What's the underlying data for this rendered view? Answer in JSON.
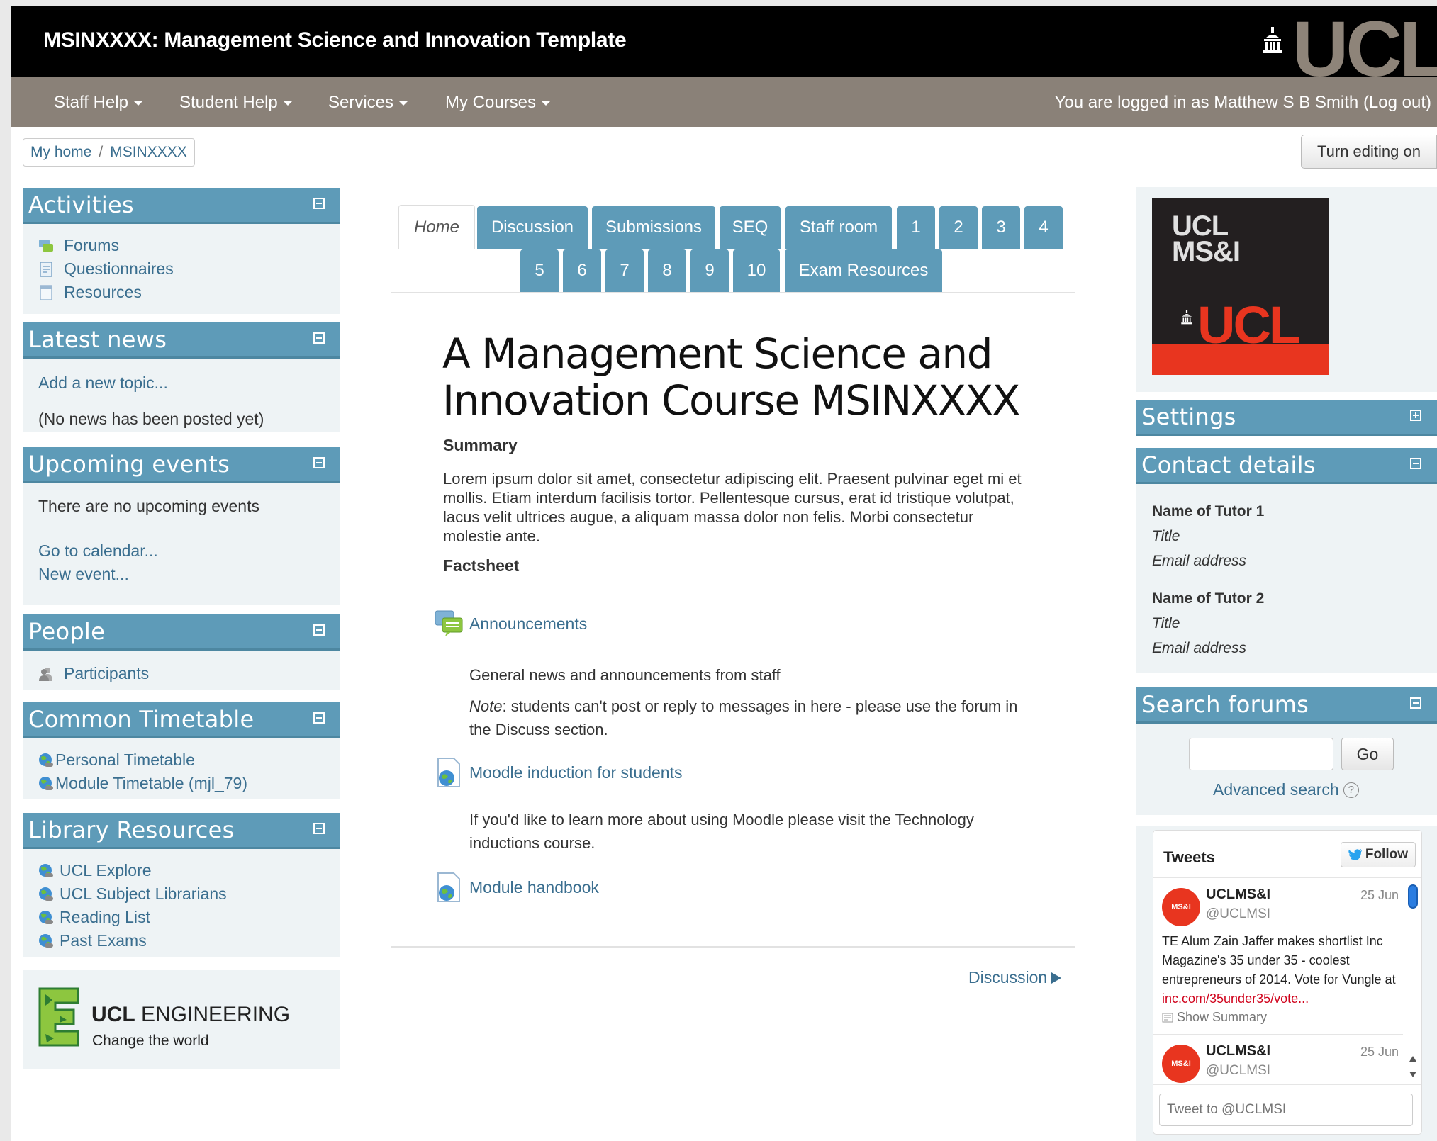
{
  "header": {
    "site_title": "MSINXXXX: Management Science and Innovation Template",
    "logo_text": "UCL"
  },
  "nav": {
    "items": [
      "Staff Help",
      "Student Help",
      "Services",
      "My Courses"
    ],
    "login_prefix": "You are logged in as Matthew S B Smith",
    "logout": "(Log out)"
  },
  "breadcrumb": {
    "home": "My home",
    "sep": "/",
    "course": "MSINXXXX"
  },
  "edit_button": "Turn editing on",
  "blocks": {
    "activities": {
      "title": "Activities",
      "items": [
        "Forums",
        "Questionnaires",
        "Resources"
      ]
    },
    "latest_news": {
      "title": "Latest news",
      "add": "Add a new topic...",
      "empty": "(No news has been posted yet)"
    },
    "upcoming": {
      "title": "Upcoming events",
      "empty": "There are no upcoming events",
      "calendar": "Go to calendar...",
      "new_event": "New event..."
    },
    "people": {
      "title": "People",
      "participants": "Participants"
    },
    "timetable": {
      "title": "Common Timetable",
      "items": [
        "Personal Timetable",
        "Module Timetable (mjl_79)"
      ]
    },
    "library": {
      "title": "Library Resources",
      "items": [
        "UCL Explore",
        "UCL Subject Librarians",
        "Reading List",
        "Past Exams"
      ]
    },
    "engineering": {
      "brand_bold": "UCL",
      "brand": "ENGINEERING",
      "tagline": "Change the world"
    },
    "msi_logo": {
      "line1": "UCL",
      "line2": "MS&I",
      "word": "UCL"
    },
    "settings": {
      "title": "Settings"
    },
    "contact": {
      "title": "Contact details",
      "tutors": [
        {
          "name": "Name of Tutor 1",
          "title": "Title",
          "email": "Email address"
        },
        {
          "name": "Name of Tutor 2",
          "title": "Title",
          "email": "Email address"
        }
      ]
    },
    "search": {
      "title": "Search forums",
      "go": "Go",
      "advanced": "Advanced search",
      "help": "?"
    }
  },
  "tabs": {
    "row1": [
      "Home",
      "Discussion",
      "Submissions",
      "SEQ",
      "Staff room",
      "1",
      "2",
      "3",
      "4"
    ],
    "row2": [
      "5",
      "6",
      "7",
      "8",
      "9",
      "10",
      "Exam Resources"
    ]
  },
  "course": {
    "title": "A Management Science and Innovation Course MSINXXXX",
    "summary_label": "Summary",
    "summary": "Lorem ipsum dolor sit amet, consectetur adipiscing elit. Praesent pulvinar eget mi et mollis. Etiam interdum facilisis tortor. Pellentesque cursus, erat id tristique volutpat, lacus velit ultrices augue, a aliquam massa dolor non felis. Morbi consectetur molestie ante.",
    "factsheet_label": "Factsheet",
    "activities": [
      {
        "name": "Announcements",
        "desc": "General news and announcements from staff",
        "note_label": "Note",
        "note": ": students can't post or reply to messages in here - please use the forum in the Discuss section."
      },
      {
        "name": "Moodle induction for students",
        "desc": "If you'd like to learn more about using Moodle please visit the Technology inductions course."
      },
      {
        "name": "Module handbook"
      }
    ],
    "next_link": "Discussion"
  },
  "tweets": {
    "header": "Tweets",
    "follow": "Follow",
    "items": [
      {
        "name": "UCLMS&I",
        "handle": "@UCLMSI",
        "date": "25 Jun",
        "text": "TE Alum Zain Jaffer makes shortlist Inc Magazine's 35 under 35 - coolest entrepreneurs of 2014. Vote for Vungle at ",
        "link": "inc.com/35under35/vote...",
        "summary": "Show Summary"
      },
      {
        "name": "UCLMS&I",
        "handle": "@UCLMSI",
        "date": "25 Jun"
      }
    ],
    "avatar_text": "MS&I",
    "compose_placeholder": "Tweet to @UCLMSI"
  },
  "colors": {
    "block_header": "#5e9bb8",
    "nav": "#8a8178",
    "link": "#3a6e8f",
    "tweet_link": "#d0021b",
    "brand_red": "#e8351f"
  }
}
